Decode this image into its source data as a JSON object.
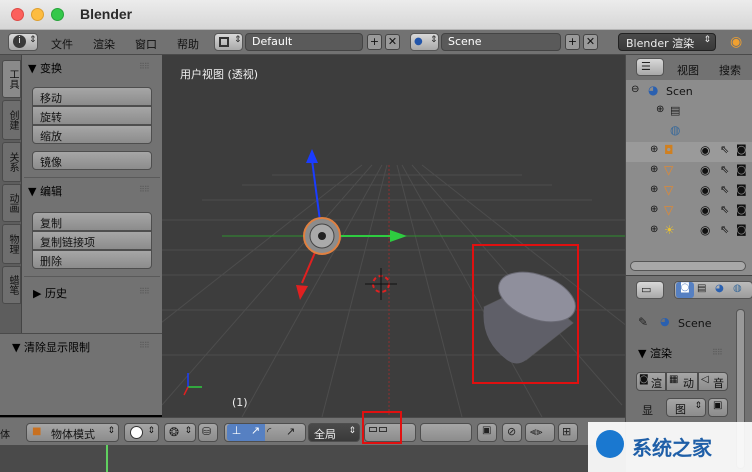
{
  "window": {
    "title": "Blender"
  },
  "info_header": {
    "menus": [
      "文件",
      "渲染",
      "窗口",
      "帮助"
    ],
    "layout_name": "Default",
    "scene_name": "Scene",
    "render_engine": "Blender 渲染"
  },
  "tool_tabs": [
    "工具",
    "创建",
    "关系",
    "动画",
    "物理",
    "蜡笔"
  ],
  "tool_shelf": {
    "transform_header": "▼ 变换",
    "transform_buttons": [
      "移动",
      "旋转",
      "缩放"
    ],
    "mirror_button": "镜像",
    "edit_header": "▼ 编辑",
    "edit_buttons": [
      "复制",
      "复制链接项",
      "删除"
    ],
    "history_header": "▶ 历史"
  },
  "lower_panel": {
    "header": "▼ 清除显示限制"
  },
  "viewport": {
    "label": "用户视图 (透视)",
    "frame": "(1)"
  },
  "bottom_header": {
    "mode": "物体模式",
    "pivot_scope": "全局"
  },
  "outliner": {
    "tabs": [
      "视图",
      "搜索"
    ],
    "scene_item": "Scen",
    "colors": {
      "object_orange": "#e8892b",
      "header_blue": "#5680c2"
    }
  },
  "properties": {
    "scene_label": "Scene",
    "render_header": "▼ 渲染",
    "render_buttons": [
      "渲",
      "动",
      "音"
    ],
    "display_label": "显",
    "display_value": "图"
  },
  "watermark": {
    "text": "系统之家"
  }
}
